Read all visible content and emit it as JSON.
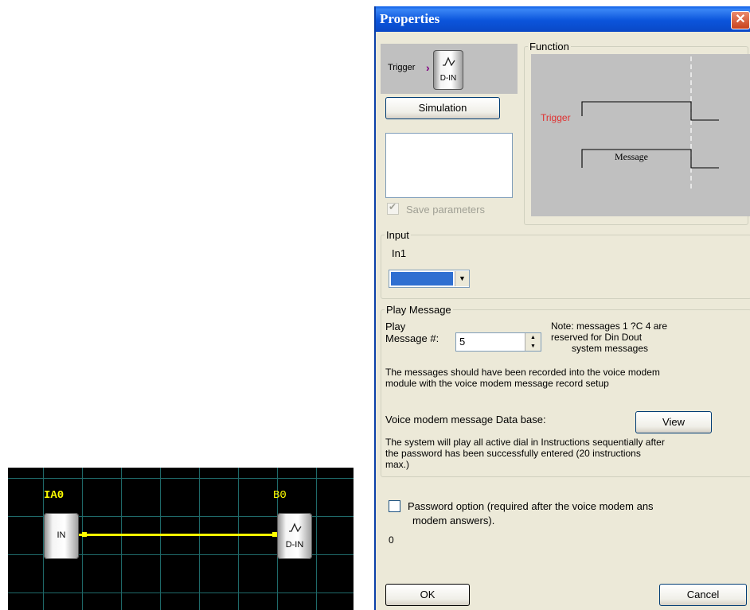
{
  "canvas": {
    "input_block": {
      "title": "IA0",
      "text": "IN"
    },
    "output_block": {
      "title": "B0",
      "text": "D-IN"
    },
    "wire_color": "#ffff00",
    "grid_color": "#1f6a6a"
  },
  "dialog": {
    "title": "Properties",
    "close_icon": "close-x-icon",
    "block_preview": {
      "trigger_label": "Trigger",
      "block_text": "D-IN"
    },
    "simulation_label": "Simulation",
    "save_parameters_label": "Save parameters",
    "function": {
      "legend": "Function",
      "trigger_label": "Trigger",
      "message_label": "Message"
    },
    "input": {
      "legend": "Input",
      "name": "In1",
      "selected_color": "#2f6fd1"
    },
    "play_message": {
      "legend": "Play Message",
      "play_label_line1": "Play",
      "play_label_line2": "Message #:",
      "message_number": "5",
      "note_line1": "Note: messages 1 ?C 4 are",
      "note_line2": "reserved for Din  Dout",
      "note_line3": "system messages",
      "info_line1": "The messages should have been recorded into the voice modem",
      "info_line2": "module with the voice modem message record setup",
      "database_label": "Voice modem message Data base:",
      "view_label": "View",
      "system_line1": "The system will play all active dial in Instructions sequentially after",
      "system_line2": "the password has been successfully entered (20 instructions",
      "system_line3": "max.)"
    },
    "password": {
      "label_line1": "Password option (required after the voice modem ans",
      "label_line2": "modem answers).",
      "value": "0"
    },
    "ok_label": "OK",
    "cancel_label": "Cancel"
  }
}
